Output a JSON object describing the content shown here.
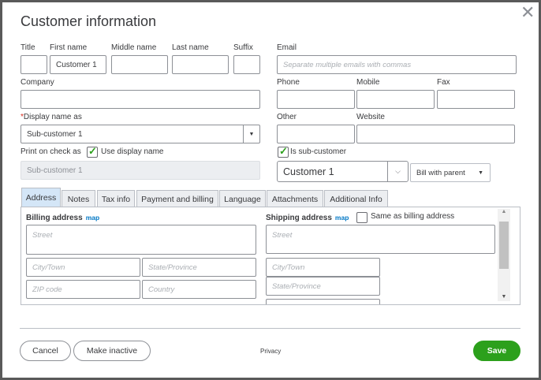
{
  "dialog": {
    "title": "Customer information",
    "close_icon": "close-icon"
  },
  "name": {
    "title_label": "Title",
    "first_label": "First name",
    "first_value": "Customer 1",
    "middle_label": "Middle name",
    "last_label": "Last name",
    "suffix_label": "Suffix"
  },
  "company": {
    "label": "Company"
  },
  "display": {
    "label": "Display name as",
    "required": "*",
    "value": "Sub-customer 1"
  },
  "print": {
    "label": "Print on check as",
    "checkbox_label": "Use display name",
    "checked": true,
    "value": "Sub-customer 1"
  },
  "email": {
    "label": "Email",
    "placeholder": "Separate multiple emails with commas"
  },
  "phone": {
    "phone_label": "Phone",
    "mobile_label": "Mobile",
    "fax_label": "Fax",
    "other_label": "Other",
    "website_label": "Website"
  },
  "sub": {
    "checkbox_label": "Is sub-customer",
    "checked": true,
    "parent": "Customer 1",
    "billing": "Bill with parent"
  },
  "tabs": [
    {
      "label": "Address",
      "active": true
    },
    {
      "label": "Notes"
    },
    {
      "label": "Tax info"
    },
    {
      "label": "Payment and billing"
    },
    {
      "label": "Language"
    },
    {
      "label": "Attachments"
    },
    {
      "label": "Additional Info"
    }
  ],
  "billing": {
    "title": "Billing address",
    "map": "map",
    "street": "Street",
    "city": "City/Town",
    "state": "State/Province",
    "zip": "ZIP code",
    "country": "Country"
  },
  "shipping": {
    "title": "Shipping address",
    "map": "map",
    "same_label": "Same as billing address",
    "same_checked": false,
    "street": "Street",
    "city": "City/Town",
    "state": "State/Province"
  },
  "footer": {
    "cancel": "Cancel",
    "inactive": "Make inactive",
    "privacy": "Privacy",
    "save": "Save"
  },
  "colors": {
    "accent": "#2ca01c",
    "link": "#0077c5",
    "active_tab": "#d4e6f7"
  }
}
